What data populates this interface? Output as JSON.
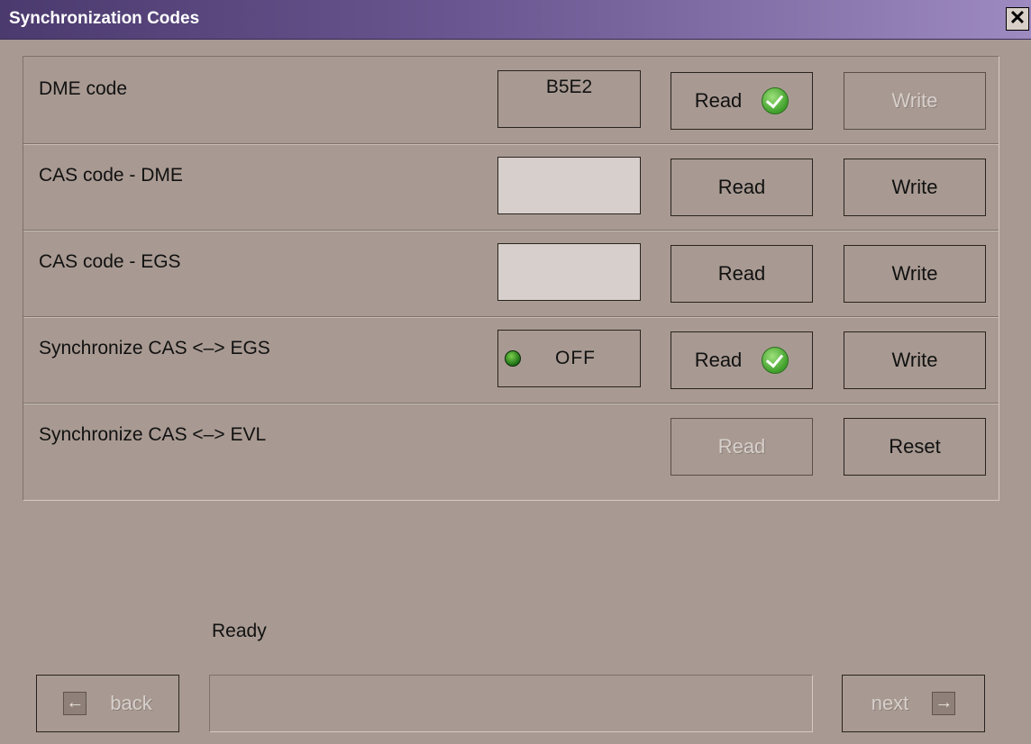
{
  "window": {
    "title": "Synchronization Codes",
    "close_glyph": "✕"
  },
  "rows": [
    {
      "label": "DME code",
      "field_value": "B5E2",
      "read_label": "Read",
      "read_status": "checked",
      "write_label": "Write",
      "write_enabled": false
    },
    {
      "label": "CAS code - DME",
      "field_value": "",
      "read_label": "Read",
      "write_label": "Write",
      "write_enabled": true
    },
    {
      "label": "CAS code - EGS",
      "field_value": "",
      "read_label": "Read",
      "write_label": "Write",
      "write_enabled": true
    },
    {
      "label": "Synchronize CAS <–> EGS",
      "toggle_value": "OFF",
      "read_label": "Read",
      "read_status": "checked",
      "write_label": "Write",
      "write_enabled": true
    },
    {
      "label": "Synchronize CAS <–> EVL",
      "read_label": "Read",
      "read_enabled": false,
      "reset_label": "Reset"
    }
  ],
  "status": {
    "text": "Ready",
    "progress": 0
  },
  "nav": {
    "back_label": "back",
    "next_label": "next",
    "back_icon": "arrow-left-icon",
    "next_icon": "arrow-right-icon"
  },
  "colors": {
    "background": "#a89a92",
    "title_gradient_start": "#4b3a6e",
    "title_gradient_end": "#9d8ac0",
    "ok_green": "#3f9f2a"
  }
}
